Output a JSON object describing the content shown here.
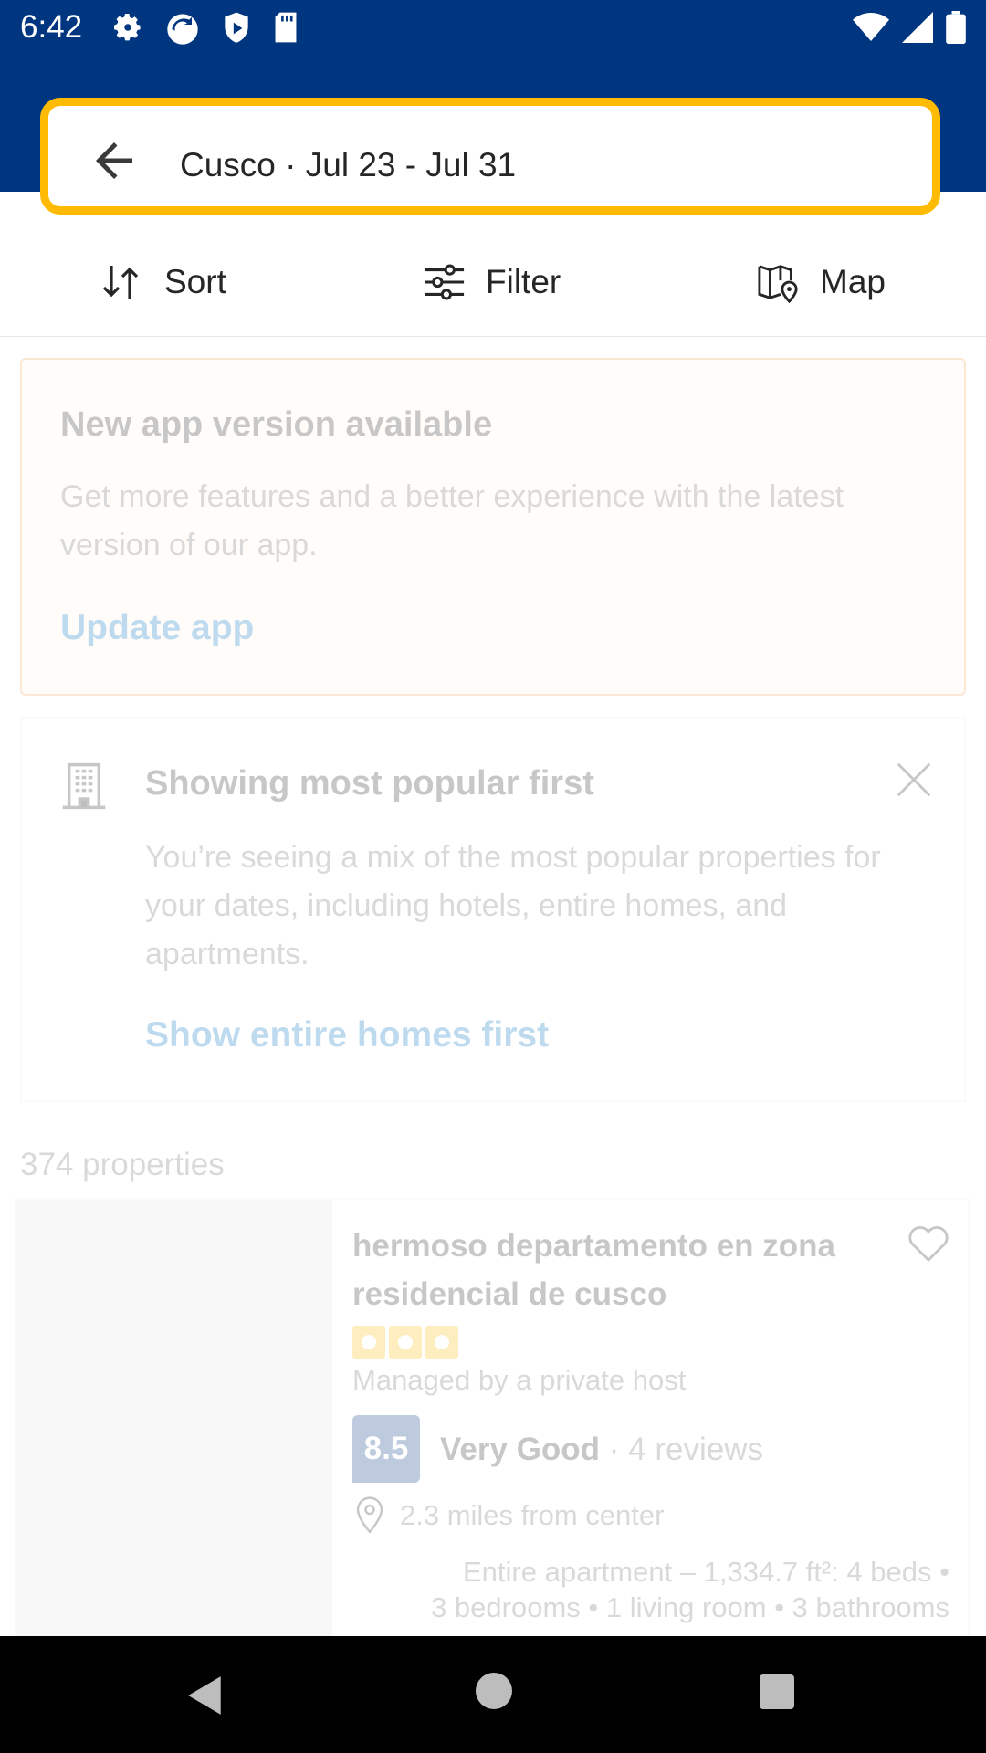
{
  "status_bar": {
    "time": "6:42"
  },
  "search": {
    "text": "Cusco · Jul 23 - Jul 31"
  },
  "toolbar": {
    "sort_label": "Sort",
    "filter_label": "Filter",
    "map_label": "Map"
  },
  "update_card": {
    "title": "New app version available",
    "body": "Get more features and a better experience with the latest version of our app.",
    "link": "Update app"
  },
  "popular_card": {
    "title": "Showing most popular first",
    "body": "You’re seeing a mix of the most popular properties for your dates, including hotels, entire homes, and apartments.",
    "link": "Show entire homes first"
  },
  "results": {
    "count": "374 properties"
  },
  "property": {
    "title": "hermoso departamento en zona residencial de cusco",
    "stars": 3,
    "managed": "Managed by a private host",
    "score": "8.5",
    "rating_word": "Very Good",
    "rating_sep": " · ",
    "reviews": "4 reviews",
    "distance": "2.3 miles from center",
    "details_line1": "Entire apartment – 1,334.7 ft²: 4 beds •",
    "details_line2": "3 bedrooms • 1 living room • 3 bathrooms"
  },
  "colors": {
    "brand": "#003580",
    "accent": "#febb02",
    "link": "#0071c2"
  }
}
